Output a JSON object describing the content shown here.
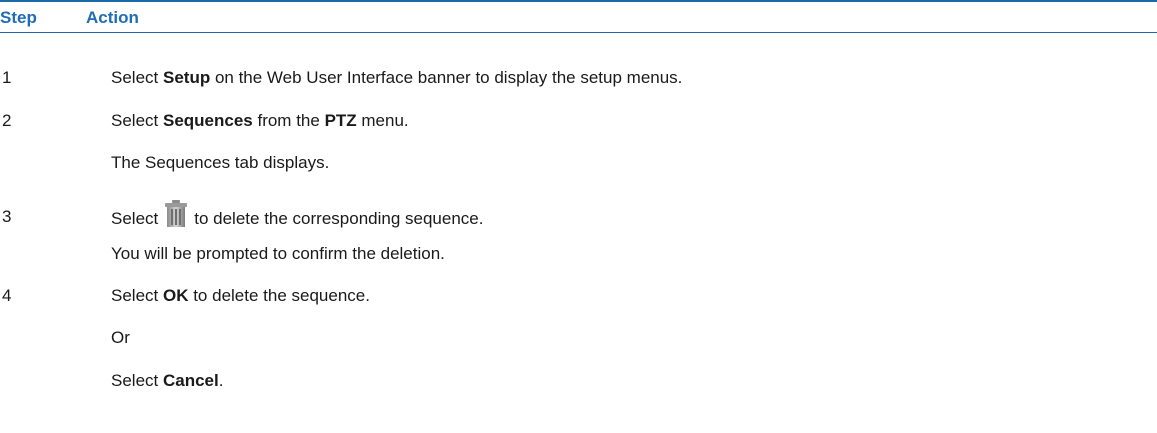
{
  "header": {
    "step": "Step",
    "action": "Action"
  },
  "steps": [
    {
      "number": "1",
      "lines": [
        {
          "pre": "Select ",
          "bold": "Setup",
          "post": " on the Web User Interface banner to display the setup menus."
        }
      ]
    },
    {
      "number": "2",
      "lines": [
        {
          "pre": "Select ",
          "bold": "Sequences",
          "mid": " from the ",
          "bold2": "PTZ",
          "post": " menu."
        },
        {
          "text": "The Sequences tab displays."
        }
      ]
    },
    {
      "number": "3",
      "lines": [
        {
          "pre": "Select",
          "icon": "trash-icon",
          "post": "to delete the corresponding sequence."
        },
        {
          "text": "You will be prompted to confirm the deletion."
        }
      ]
    },
    {
      "number": "4",
      "lines": [
        {
          "pre": "Select ",
          "bold": "OK",
          "post": " to delete the sequence."
        },
        {
          "text": "Or"
        },
        {
          "pre": "Select ",
          "bold": "Cancel",
          "post": "."
        }
      ]
    }
  ],
  "colors": {
    "header_text": "#1f6db5",
    "rule": "#1b6aa8"
  }
}
